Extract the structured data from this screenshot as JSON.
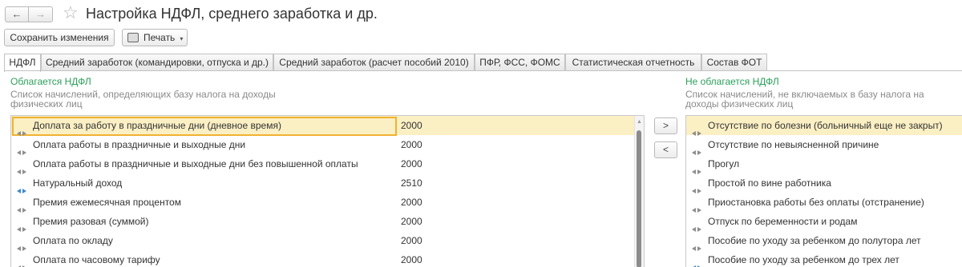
{
  "window": {
    "title": "Настройка НДФЛ, среднего заработка и др.",
    "back_label": "←",
    "forward_label": "→"
  },
  "toolbar": {
    "save_label": "Сохранить изменения",
    "print_label": "Печать",
    "caret": "▾"
  },
  "tabs": [
    {
      "label": "НДФЛ"
    },
    {
      "label": "Средний заработок (командировки, отпуска и др.)"
    },
    {
      "label": "Средний заработок (расчет пособий 2010)"
    },
    {
      "label": "ПФР, ФСС, ФОМС"
    },
    {
      "label": "Статистическая отчетность"
    },
    {
      "label": "Состав ФОТ"
    }
  ],
  "left": {
    "title": "Облагается НДФЛ",
    "description": "Список начислений, определяющих базу налога на доходы физических лиц",
    "rows": [
      {
        "name": "Доплата за работу в праздничные дни (дневное время)",
        "code": "2000",
        "icon": "gray-arrows-icon"
      },
      {
        "name": "Оплата работы в праздничные и выходные дни",
        "code": "2000",
        "icon": "gray-arrows-icon"
      },
      {
        "name": "Оплата работы в праздничные и выходные дни без повышенной оплаты",
        "code": "2000",
        "icon": "gray-arrows-icon"
      },
      {
        "name": "Натуральный доход",
        "code": "2510",
        "icon": "blue-arrows-icon"
      },
      {
        "name": "Премия ежемесячная процентом",
        "code": "2000",
        "icon": "gray-arrows-icon"
      },
      {
        "name": "Премия разовая (суммой)",
        "code": "2000",
        "icon": "gray-arrows-icon"
      },
      {
        "name": "Оплата по окладу",
        "code": "2000",
        "icon": "gray-arrows-icon"
      },
      {
        "name": "Оплата по часовому тарифу",
        "code": "2000",
        "icon": "gray-arrows-icon"
      }
    ]
  },
  "move": {
    "right_label": ">",
    "left_label": "<"
  },
  "right": {
    "title": "Не облагается НДФЛ",
    "description": "Список начислений, не включаемых в базу налога на доходы физических лиц",
    "rows": [
      {
        "name": "Отсутствие по болезни (больничный еще не закрыт)",
        "icon": "gray-arrows-icon"
      },
      {
        "name": "Отсутствие по невыясненной причине",
        "icon": "gray-arrows-icon"
      },
      {
        "name": "Прогул",
        "icon": "gray-arrows-icon"
      },
      {
        "name": "Простой по вине работника",
        "icon": "gray-arrows-icon"
      },
      {
        "name": "Приостановка работы без оплаты (отстранение)",
        "icon": "gray-arrows-icon"
      },
      {
        "name": "Отпуск по беременности и родам",
        "icon": "gray-arrows-icon"
      },
      {
        "name": "Пособие по уходу за ребенком до полутора лет",
        "icon": "gray-arrows-icon"
      },
      {
        "name": "Пособие по уходу за ребенком до трех лет",
        "icon": "blue-arrows-icon"
      }
    ]
  },
  "colors": {
    "accent_green": "#2c9f5b",
    "selection_fill": "#fbefc4",
    "selection_border": "#f0b232"
  }
}
